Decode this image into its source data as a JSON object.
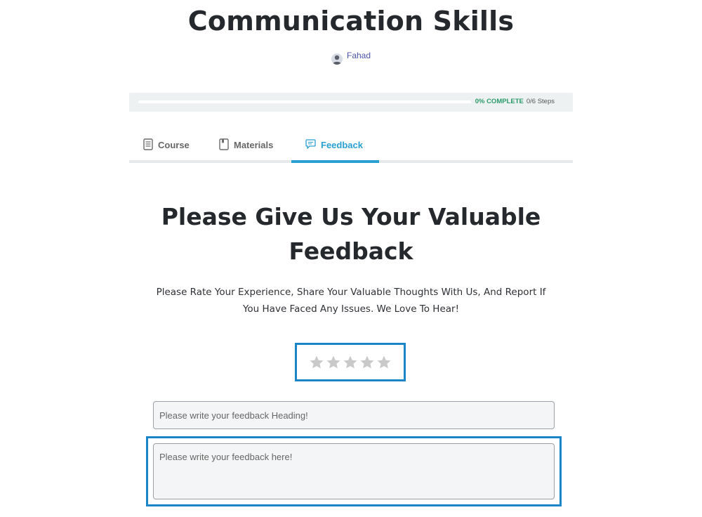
{
  "course": {
    "title": "Communication Skills",
    "author": "Fahad"
  },
  "progress": {
    "percent_label": "0% COMPLETE",
    "steps_label": "0/6 Steps",
    "completed_steps": 0,
    "total_steps": 6
  },
  "tabs": [
    {
      "label": "Course",
      "icon": "document-icon",
      "active": false
    },
    {
      "label": "Materials",
      "icon": "book-icon",
      "active": false
    },
    {
      "label": "Feedback",
      "icon": "chat-bubble-icon",
      "active": true
    }
  ],
  "feedback": {
    "heading": "Please Give Us Your Valuable Feedback",
    "subtext": "Please Rate Your Experience, Share Your Valuable Thoughts With Us, And Report If You Have Faced Any Issues. We Love To Hear!",
    "rating": {
      "value": 0,
      "max": 5
    },
    "heading_field": {
      "value": "",
      "placeholder": "Please write your feedback Heading!"
    },
    "body_field": {
      "value": "",
      "placeholder": "Please write your feedback here!"
    }
  },
  "colors": {
    "accent": "#2a9fd1",
    "outline": "#1a85c7",
    "progress": "#2b9a6a",
    "star_empty": "#c9c9c9",
    "author": "#4a52a6"
  }
}
